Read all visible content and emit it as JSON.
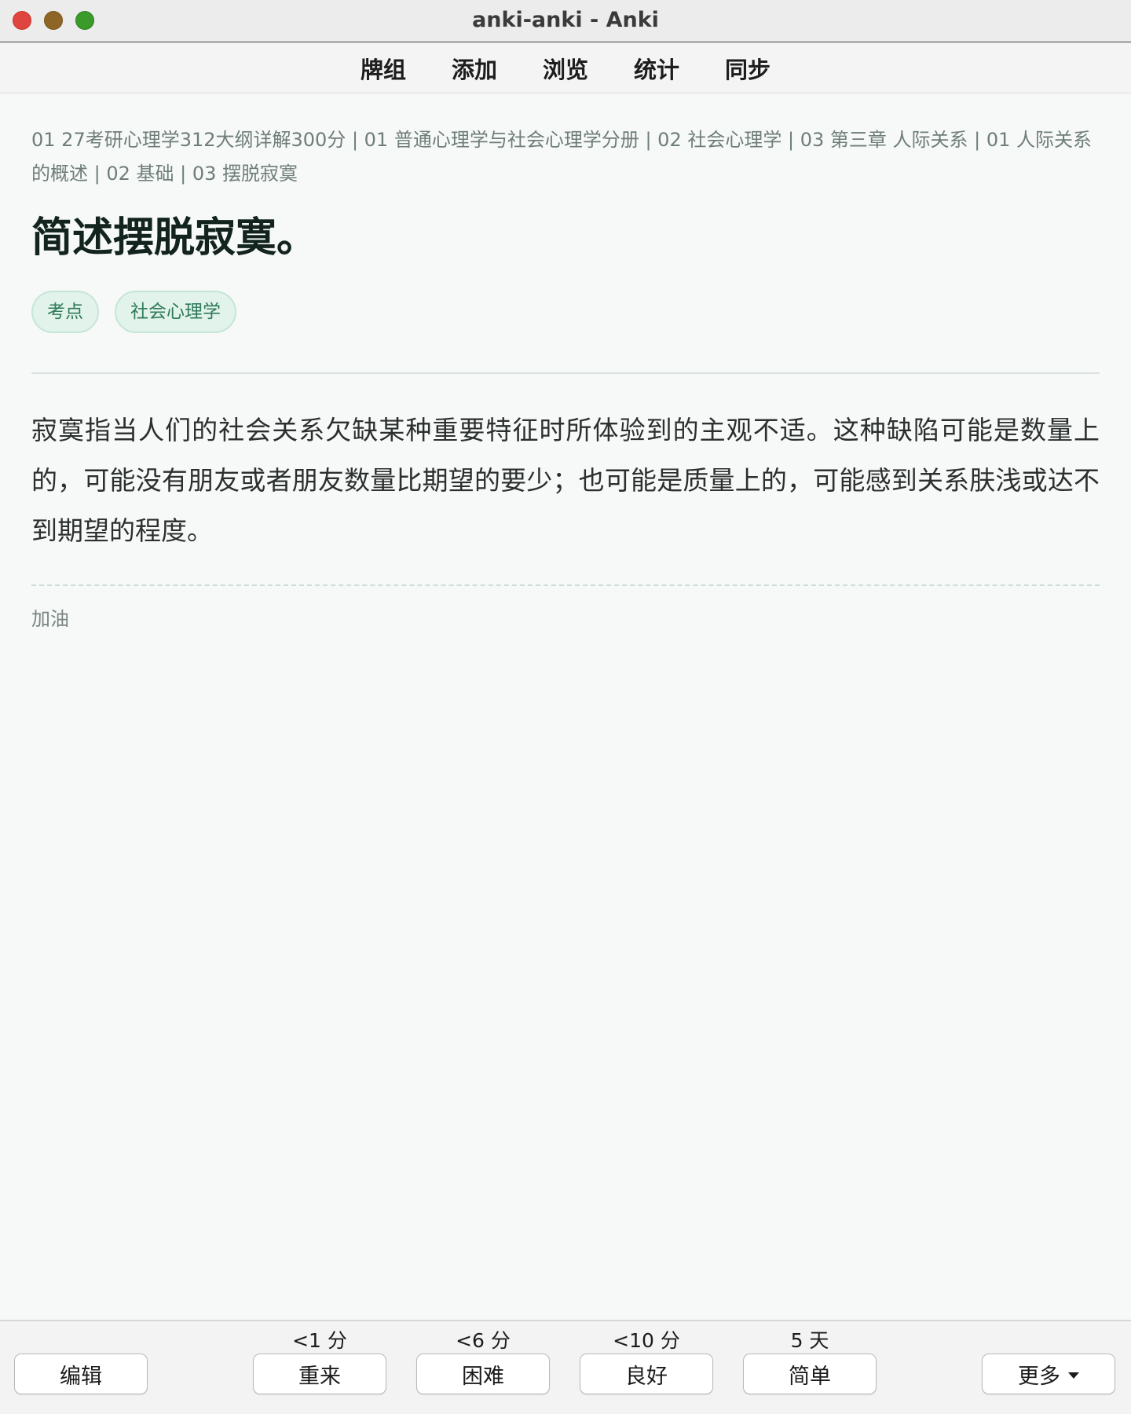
{
  "window": {
    "title": "anki-anki - Anki"
  },
  "nav": {
    "items": [
      "牌组",
      "添加",
      "浏览",
      "统计",
      "同步"
    ]
  },
  "card": {
    "deck_path": "01 27考研心理学312大纲详解300分 | 01 普通心理学与社会心理学分册 | 02 社会心理学 | 03 第三章 人际关系 | 01 人际关系的概述 | 02 基础 | 03 摆脱寂寞",
    "question": "简述摆脱寂寞。",
    "tags": [
      "考点",
      "社会心理学"
    ],
    "answer": "寂寞指当人们的社会关系欠缺某种重要特征时所体验到的主观不适。这种缺陷可能是数量上的，可能没有朋友或者朋友数量比期望的要少；也可能是质量上的，可能感到关系肤浅或达不到期望的程度。",
    "extra": "加油"
  },
  "bottom": {
    "edit_label": "编辑",
    "more_label": "更多",
    "answers": [
      {
        "label": "重来",
        "interval": "<1 分"
      },
      {
        "label": "困难",
        "interval": "<6 分"
      },
      {
        "label": "良好",
        "interval": "<10 分"
      },
      {
        "label": "简单",
        "interval": "5 天"
      }
    ]
  },
  "colors": {
    "background": "#f6f9f8",
    "tag_bg": "#e1f3ea",
    "tag_text": "#2f7a5a",
    "close": "#e0443e",
    "minimize": "#8f6526",
    "zoom": "#3a9a2a"
  }
}
